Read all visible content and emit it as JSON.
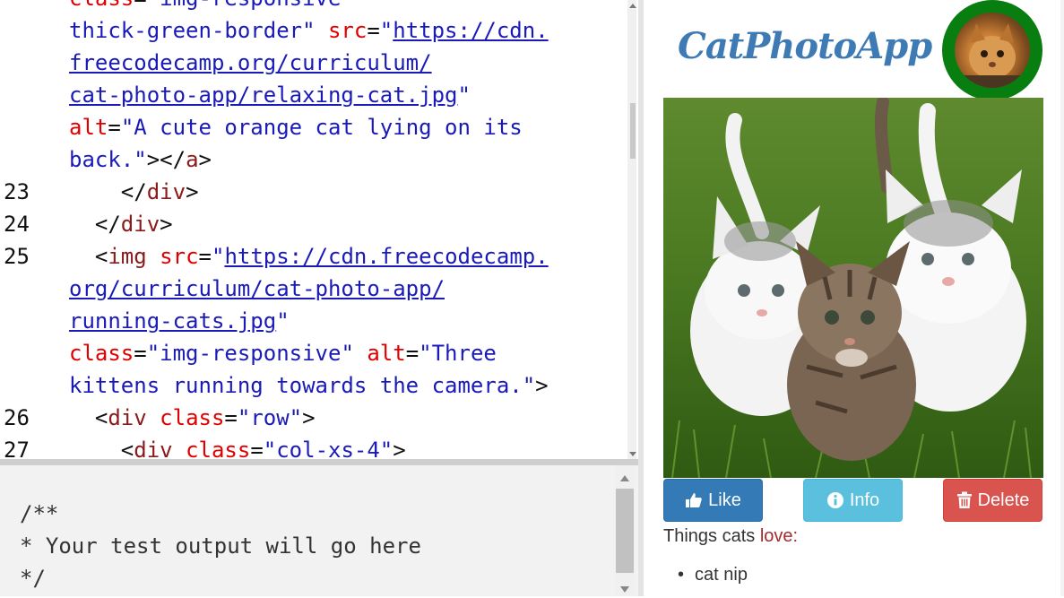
{
  "editor": {
    "lines": [
      {
        "num": "",
        "tokens": [
          [
            "attr",
            "class"
          ],
          [
            "punc",
            "="
          ],
          [
            "str",
            "\"img-responsive"
          ]
        ]
      },
      {
        "num": "",
        "tokens": [
          [
            "str",
            "thick-green-border\" "
          ],
          [
            "attr",
            "src"
          ],
          [
            "punc",
            "="
          ],
          [
            "str",
            "\""
          ],
          [
            "url",
            "https://cdn."
          ]
        ]
      },
      {
        "num": "",
        "tokens": [
          [
            "url",
            "freecodecamp.org/curriculum/"
          ]
        ]
      },
      {
        "num": "",
        "tokens": [
          [
            "url",
            "cat-photo-app/relaxing-cat.jpg"
          ],
          [
            "str",
            "\""
          ]
        ]
      },
      {
        "num": "",
        "tokens": [
          [
            "attr",
            "alt"
          ],
          [
            "punc",
            "="
          ],
          [
            "str",
            "\"A cute orange cat lying on its"
          ]
        ]
      },
      {
        "num": "",
        "tokens": [
          [
            "str",
            "back.\""
          ],
          [
            "punc",
            "></"
          ],
          [
            "tag",
            "a"
          ],
          [
            "punc",
            ">"
          ]
        ]
      },
      {
        "num": "23",
        "tokens": [
          [
            "punc",
            "    </"
          ],
          [
            "tag",
            "div"
          ],
          [
            "punc",
            ">"
          ]
        ]
      },
      {
        "num": "24",
        "tokens": [
          [
            "punc",
            "  </"
          ],
          [
            "tag",
            "div"
          ],
          [
            "punc",
            ">"
          ]
        ]
      },
      {
        "num": "25",
        "tokens": [
          [
            "punc",
            "  <"
          ],
          [
            "tag",
            "img"
          ],
          [
            "punc",
            " "
          ],
          [
            "attr",
            "src"
          ],
          [
            "punc",
            "="
          ],
          [
            "str",
            "\""
          ],
          [
            "url",
            "https://cdn.freecodecamp."
          ]
        ]
      },
      {
        "num": "",
        "tokens": [
          [
            "url",
            "org/curriculum/cat-photo-app/"
          ]
        ]
      },
      {
        "num": "",
        "tokens": [
          [
            "url",
            "running-cats.jpg"
          ],
          [
            "str",
            "\""
          ]
        ]
      },
      {
        "num": "",
        "tokens": [
          [
            "attr",
            "class"
          ],
          [
            "punc",
            "="
          ],
          [
            "str",
            "\"img-responsive\" "
          ],
          [
            "attr",
            "alt"
          ],
          [
            "punc",
            "="
          ],
          [
            "str",
            "\"Three"
          ]
        ]
      },
      {
        "num": "",
        "tokens": [
          [
            "str",
            "kittens running towards the camera.\""
          ],
          [
            "punc",
            ">"
          ]
        ]
      },
      {
        "num": "26",
        "tokens": [
          [
            "punc",
            "  <"
          ],
          [
            "tag",
            "div"
          ],
          [
            "punc",
            " "
          ],
          [
            "attr",
            "class"
          ],
          [
            "punc",
            "="
          ],
          [
            "str",
            "\"row\""
          ],
          [
            "punc",
            ">"
          ]
        ]
      },
      {
        "num": "27",
        "tokens": [
          [
            "punc",
            "    <"
          ],
          [
            "tag",
            "div"
          ],
          [
            "punc",
            " "
          ],
          [
            "attr",
            "class"
          ],
          [
            "punc",
            "="
          ],
          [
            "str",
            "\"col-xs-4\""
          ],
          [
            "punc",
            ">"
          ]
        ]
      }
    ]
  },
  "output": {
    "text": "/**\n* Your test output will go here\n*/"
  },
  "preview": {
    "title": "CatPhotoApp",
    "profile_alt": "cat profile photo",
    "photo_alt": "Three kittens running towards the camera.",
    "buttons": {
      "like": "Like",
      "info": "Info",
      "delete": "Delete"
    },
    "things_prefix": "Things cats ",
    "things_love": "love:",
    "list": [
      "cat nip"
    ]
  },
  "colors": {
    "title": "#3e7ab3",
    "profile_border": "#087d10",
    "like": "#337ab7",
    "info": "#5bc0de",
    "delete": "#d9534f"
  },
  "icons": {
    "like": "thumbs-up-icon",
    "info": "info-circle-icon",
    "delete": "trash-icon"
  }
}
